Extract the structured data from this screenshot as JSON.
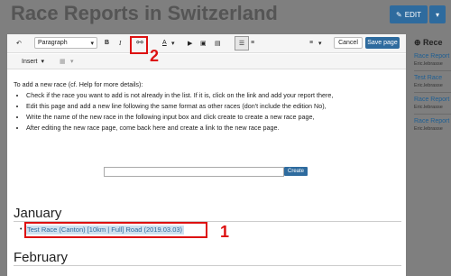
{
  "page": {
    "title": "Race Reports in Switzerland"
  },
  "header": {
    "edit_label": "EDIT",
    "caret": "▾"
  },
  "toolbar": {
    "undo": "↶",
    "paragraph": "Paragraph",
    "dropdown_caret": "▾",
    "bold": "B",
    "italic": "I",
    "link": "⚯",
    "font_color": "A",
    "media": "▶",
    "image": "▣",
    "gallery": "▤",
    "bullet_list": "☰",
    "numbered_list": "≡",
    "more": "≡",
    "cancel": "Cancel",
    "save": "Save page",
    "insert": "Insert",
    "table": "▦"
  },
  "annotations": {
    "label_1": "1",
    "label_2": "2"
  },
  "content": {
    "intro": "To add a new race (cf. Help for more details):",
    "bullets": [
      "Check if the race you want to add is not already in the list. If it is, click on the link and add your report there,",
      "Edit this page and add a new line following the same format as other races (don't include the edition No),",
      "Write the name of the new race in the following input box and click create to create a new race page,",
      "After editing the new race page, come back here and create a link to the new race page."
    ],
    "create_label": "Create",
    "section1": "January",
    "race_item": "Test Race (Canton) [10km | Full] Road (2019.03.03)",
    "section2": "February"
  },
  "sidebar": {
    "heading": "Rece",
    "items": [
      {
        "title": "Race Report",
        "sub": "Eric.lebrasse"
      },
      {
        "title": "Test Race",
        "sub": "Eric.lebrasse"
      },
      {
        "title": "Race Report",
        "sub": "Eric.lebrasse"
      },
      {
        "title": "Race Report",
        "sub": "Eric.lebrasse"
      }
    ]
  },
  "colors": {
    "accent": "#2e6b9e",
    "annotation": "#d11111",
    "overlay": "#7f7f7f"
  }
}
